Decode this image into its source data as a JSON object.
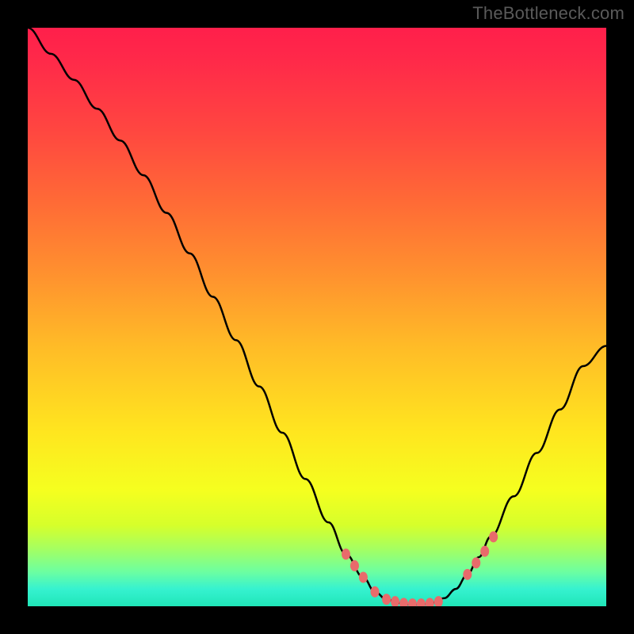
{
  "watermark": "TheBottleneck.com",
  "colors": {
    "page_bg": "#000000",
    "watermark": "#5a5a5a",
    "curve": "#000000",
    "markers": "#e86b6b",
    "gradient_top": "#ff1f4b",
    "gradient_bottom": "#20e6b8"
  },
  "chart_data": {
    "type": "line",
    "title": "",
    "xlabel": "",
    "ylabel": "",
    "xlim": [
      0,
      100
    ],
    "ylim": [
      0,
      100
    ],
    "grid": false,
    "curve_points": [
      [
        0,
        100
      ],
      [
        4,
        95.5
      ],
      [
        8,
        91
      ],
      [
        12,
        86
      ],
      [
        16,
        80.5
      ],
      [
        20,
        74.5
      ],
      [
        24,
        68
      ],
      [
        28,
        61
      ],
      [
        32,
        53.5
      ],
      [
        36,
        46
      ],
      [
        40,
        38
      ],
      [
        44,
        30
      ],
      [
        48,
        22
      ],
      [
        52,
        14.5
      ],
      [
        55,
        9
      ],
      [
        58,
        5
      ],
      [
        60,
        2.5
      ],
      [
        62,
        1.2
      ],
      [
        64,
        0.6
      ],
      [
        66,
        0.3
      ],
      [
        68,
        0.3
      ],
      [
        70,
        0.6
      ],
      [
        72,
        1.4
      ],
      [
        74,
        3
      ],
      [
        76,
        5.5
      ],
      [
        78,
        8.5
      ],
      [
        80,
        12
      ],
      [
        84,
        19
      ],
      [
        88,
        26.5
      ],
      [
        92,
        34
      ],
      [
        96,
        41.5
      ],
      [
        100,
        45
      ]
    ],
    "series": [
      {
        "name": "markers",
        "type": "scatter",
        "x": [
          55,
          56.5,
          58,
          60,
          62,
          63.5,
          65,
          66.5,
          68,
          69.5,
          71,
          76,
          77.5,
          79,
          80.5
        ],
        "y": [
          9,
          7,
          5,
          2.5,
          1.2,
          0.8,
          0.5,
          0.4,
          0.4,
          0.5,
          0.8,
          5.5,
          7.5,
          9.5,
          12
        ]
      }
    ]
  }
}
